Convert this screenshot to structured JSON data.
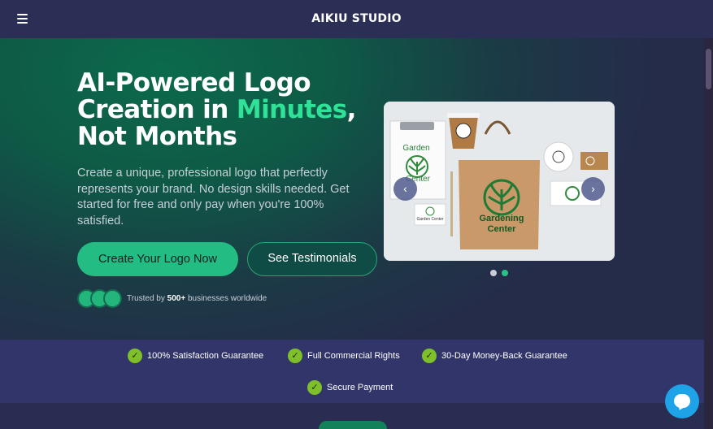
{
  "header": {
    "brand": "AIKIU STUDIO",
    "menu_icon": "hamburger-icon"
  },
  "hero": {
    "title_line1": "AI-Powered Logo",
    "title_line2_a": "Creation in ",
    "title_line2_accent": "Minutes",
    "title_line2_b": ",",
    "title_line3": "Not Months",
    "subtitle": "Create a unique, professional logo that perfectly represents your brand. No design skills needed. Get started for free and only pay when you're 100% satisfied.",
    "cta_primary": "Create Your Logo Now",
    "cta_secondary": "See Testimonials",
    "trusted_prefix": "Trusted by ",
    "trusted_count": "500+",
    "trusted_suffix": " businesses worldwide"
  },
  "carousel": {
    "slide_texts": {
      "card_line1": "Garden",
      "card_line2": "Center",
      "bag_line1": "Gardening",
      "bag_line2": "Center",
      "small_label": "Garden Center"
    },
    "prev_icon": "‹",
    "next_icon": "›",
    "dots": [
      {
        "active": false
      },
      {
        "active": true
      }
    ]
  },
  "guarantees": [
    {
      "label": "100% Satisfaction Guarantee"
    },
    {
      "label": "Full Commercial Rights"
    },
    {
      "label": "30-Day Money-Back Guarantee"
    },
    {
      "label": "Secure Payment"
    }
  ],
  "colors": {
    "accent": "#2ee398",
    "primary_button": "#23bd84",
    "check": "#7fc02a",
    "chat": "#1fa3e8"
  }
}
